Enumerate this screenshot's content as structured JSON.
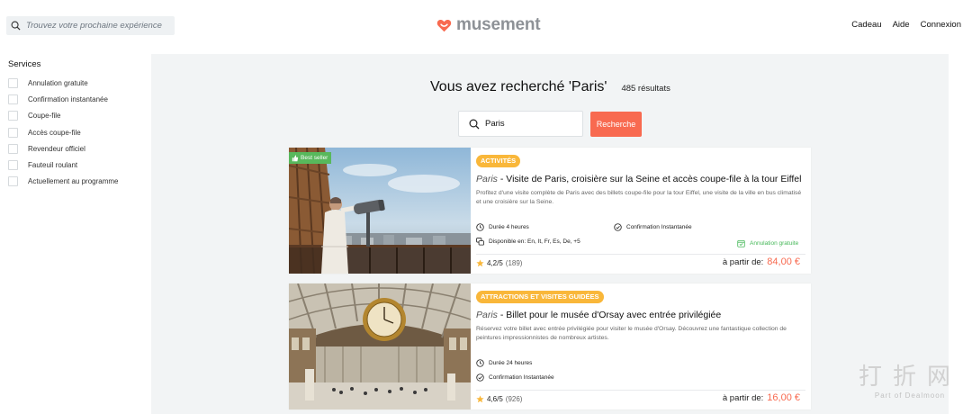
{
  "header": {
    "search_placeholder": "Trouvez votre prochaine expérience",
    "logo_text": "musement",
    "nav": [
      "Cadeau",
      "Aide",
      "Connexion"
    ]
  },
  "sidebar": {
    "title": "Services",
    "filters": [
      "Annulation gratuite",
      "Confirmation instantanée",
      "Coupe-file",
      "Accès coupe-file",
      "Revendeur officiel",
      "Fauteuil roulant",
      "Actuellement au programme"
    ]
  },
  "results": {
    "title": "Vous avez recherché 'Paris'",
    "count": "485 résultats",
    "search_value": "Paris",
    "search_button": "Recherche"
  },
  "cards": [
    {
      "badge": "Best seller",
      "category": "ACTIVITÉS",
      "city": "Paris",
      "separator": " - ",
      "title": "Visite de Paris, croisière sur la Seine et accès coupe-file à la tour Eiffel",
      "description": "Profitez d'une visite complète de Paris avec des billets coupe-file pour la tour Eiffel, une visite de la ville en bus climatisé et une croisière sur la Seine.",
      "duration": "Durée 4 heures",
      "confirmation": "Confirmation Instantanée",
      "languages": "Disponible en: En, It, Fr, Es, De, +5",
      "cancellation": "Annulation gratuite",
      "rating": "4,2/5",
      "reviews": "(189)",
      "price_from": "à partir de:",
      "price": "84,00 €"
    },
    {
      "category": "ATTRACTIONS ET VISITES GUIDÉES",
      "city": "Paris",
      "separator": " - ",
      "title": "Billet pour le musée d'Orsay avec entrée privilégiée",
      "description": "Réservez votre billet avec entrée privilégiée pour visiter le musée d'Orsay. Découvrez une fantastique collection de peintures impressionnistes de nombreux artistes.",
      "duration": "Durée 24 heures",
      "confirmation": "Confirmation Instantanée",
      "rating": "4,6/5",
      "reviews": "(926)",
      "price_from": "à partir de:",
      "price": "16,00 €"
    }
  ],
  "watermark": {
    "big": "打折网",
    "small": "Part of Dealmoon"
  },
  "colors": {
    "accent": "#f86a50",
    "badge": "#f9b73a",
    "green": "#44b757",
    "main_bg": "#f2f4f5"
  }
}
